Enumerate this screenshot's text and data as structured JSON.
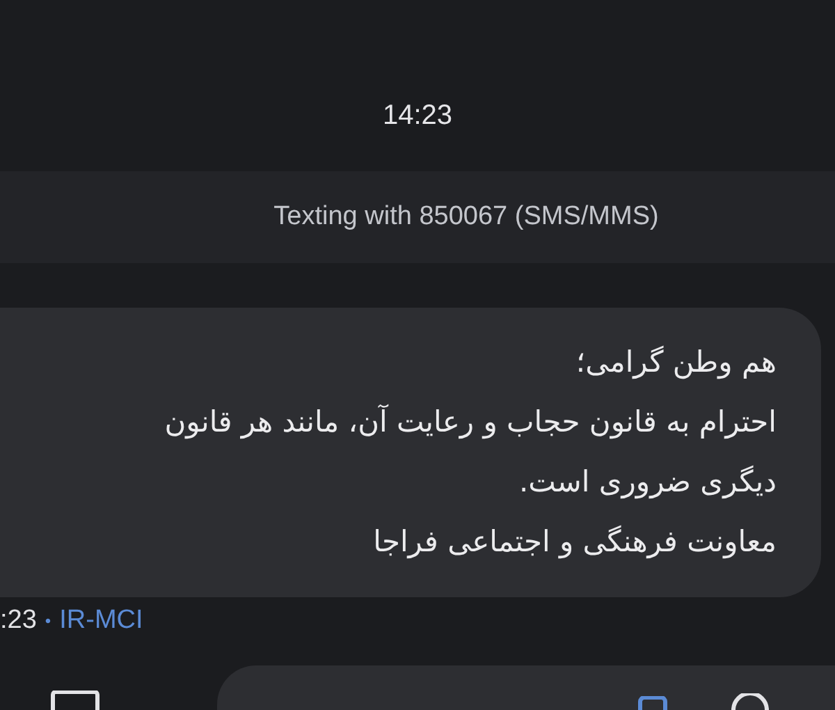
{
  "time_header": "14:23",
  "banner": "Texting with 850067 (SMS/MMS)",
  "message": {
    "lines": [
      "هم وطن گرامی؛",
      "احترام به قانون حجاب و رعایت آن، مانند هر قانون",
      "دیگری ضروری است.",
      "معاونت فرهنگی و اجتماعی فراجا"
    ]
  },
  "meta": {
    "time": ":23",
    "separator": "•",
    "carrier": "IR-MCI"
  }
}
